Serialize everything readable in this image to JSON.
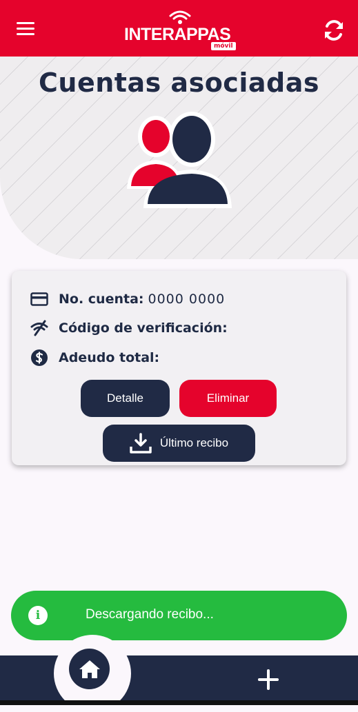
{
  "app": {
    "logo_text": "INTERAPPAS",
    "logo_sub": "móvil"
  },
  "header": {
    "menu_icon": "hamburger-menu-icon",
    "refresh_icon": "refresh-icon"
  },
  "page": {
    "title": "Cuentas asociadas",
    "avatar_icon": "associated-users-icon"
  },
  "account_card": {
    "account_label": "No. cuenta:",
    "account_value": "0000 0000",
    "verification_label": "Código de verificación:",
    "verification_value": "",
    "debt_label": "Adeudo total:",
    "debt_value": "",
    "detail_button": "Detalle",
    "delete_button": "Eliminar",
    "receipt_button": "Último recibo"
  },
  "toast": {
    "message": "Descargando recibo...",
    "icon": "info-icon"
  },
  "bottom_nav": {
    "home_icon": "home-icon",
    "add_icon": "plus-icon"
  },
  "colors": {
    "brand_red": "#e5032c",
    "navy": "#202a45",
    "success_green": "#25bb3f"
  }
}
